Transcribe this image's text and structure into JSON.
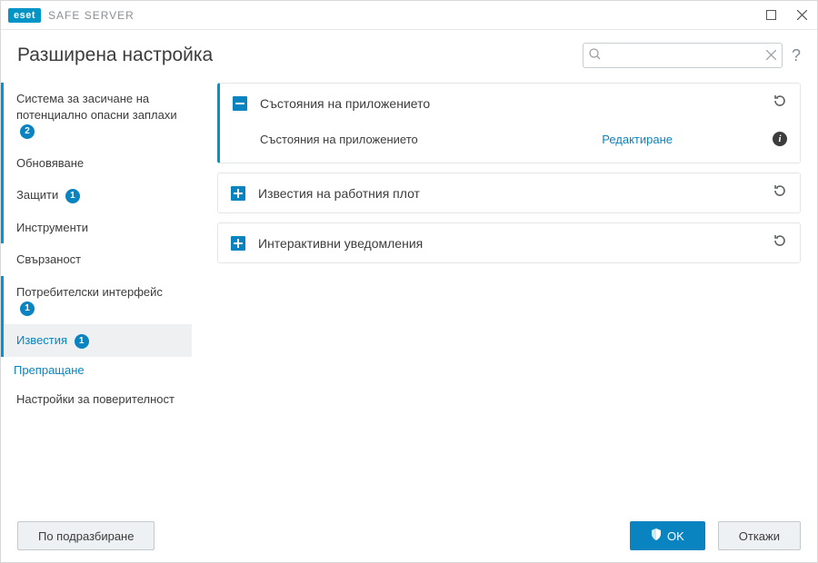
{
  "titlebar": {
    "logo": "eset",
    "app": "SAFE SERVER"
  },
  "header": {
    "title": "Разширена настройка",
    "search_placeholder": ""
  },
  "sidebar": {
    "items": [
      {
        "label": "Система за засичане на потенциално опасни заплахи",
        "badge": "2",
        "active": true
      },
      {
        "label": "Обновяване",
        "badge": null,
        "active": true
      },
      {
        "label": "Защити",
        "badge": "1",
        "active": true
      },
      {
        "label": "Инструменти",
        "badge": null,
        "active": true
      },
      {
        "label": "Свързаност",
        "badge": null,
        "active": false
      },
      {
        "label": "Потребителски интерфейс",
        "badge": "1",
        "active": true
      },
      {
        "label": "Известия",
        "badge": "1",
        "active": true,
        "selected": true,
        "sub": "Препращане"
      },
      {
        "label": "Настройки за поверителност",
        "badge": null,
        "active": false
      }
    ]
  },
  "main": {
    "panels": [
      {
        "title": "Състояния на приложението",
        "expanded": true,
        "rows": [
          {
            "label": "Състояния на приложението",
            "action": "Редактиране"
          }
        ]
      },
      {
        "title": "Известия на работния плот",
        "expanded": false
      },
      {
        "title": "Интерактивни уведомления",
        "expanded": false
      }
    ]
  },
  "footer": {
    "default": "По подразбиране",
    "ok": "OK",
    "cancel": "Откажи"
  }
}
